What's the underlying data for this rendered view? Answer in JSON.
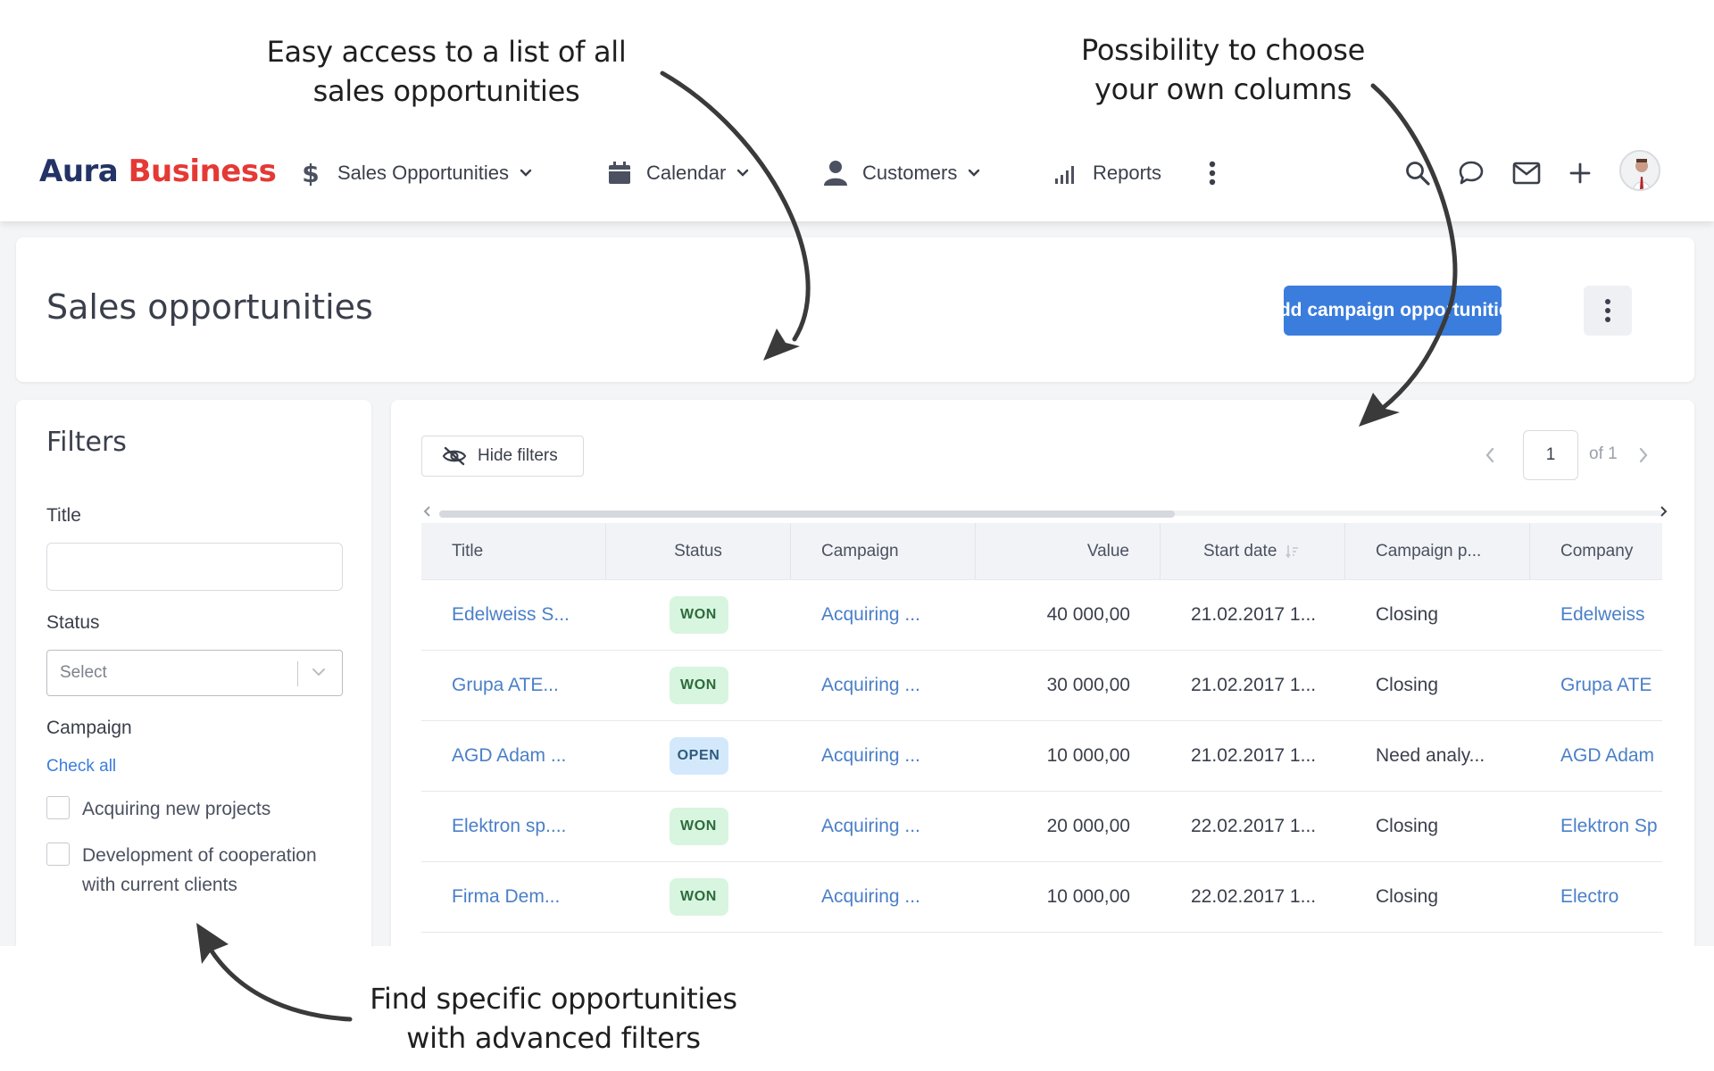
{
  "annotations": {
    "list": [
      "Easy access to a list of all",
      "sales opportunities"
    ],
    "columns": [
      "Possibility to choose",
      "your own columns"
    ],
    "filters": [
      "Find specific opportunities",
      "with advanced filters"
    ]
  },
  "brand": {
    "part1": "Aura",
    "part2": "Business",
    "color1": "#243366",
    "color2": "#e53935"
  },
  "nav": {
    "sales": "Sales Opportunities",
    "calendar": "Calendar",
    "customers": "Customers",
    "reports": "Reports"
  },
  "toolbar_icons": [
    "search-icon",
    "chat-icon",
    "mail-icon",
    "plus-icon",
    "avatar"
  ],
  "header": {
    "title": "Sales opportunities",
    "add_button": "Add campaign opportunities",
    "accent": "#3b7ddd"
  },
  "filters": {
    "title": "Filters",
    "title_label": "Title",
    "title_value": "",
    "status_label": "Status",
    "status_placeholder": "Select",
    "campaign_label": "Campaign",
    "check_all": "Check all",
    "campaign_options": [
      "Acquiring new projects",
      "Development of cooperation with current clients"
    ]
  },
  "table_toolbar": {
    "hide_filters": "Hide filters",
    "page": "1",
    "page_of": "of 1"
  },
  "table": {
    "columns": [
      "Title",
      "Status",
      "Campaign",
      "Value",
      "Start date",
      "Campaign p...",
      "Company"
    ],
    "rows": [
      {
        "title": "Edelweiss S...",
        "status": "WON",
        "campaign": "Acquiring ...",
        "value": "40 000,00",
        "start_date": "21.02.2017 1...",
        "phase": "Closing",
        "company": "Edelweiss"
      },
      {
        "title": "Grupa ATE...",
        "status": "WON",
        "campaign": "Acquiring ...",
        "value": "30 000,00",
        "start_date": "21.02.2017 1...",
        "phase": "Closing",
        "company": "Grupa ATE"
      },
      {
        "title": "AGD Adam ...",
        "status": "OPEN",
        "campaign": "Acquiring ...",
        "value": "10 000,00",
        "start_date": "21.02.2017 1...",
        "phase": "Need analy...",
        "company": "AGD Adam"
      },
      {
        "title": "Elektron sp....",
        "status": "WON",
        "campaign": "Acquiring ...",
        "value": "20 000,00",
        "start_date": "22.02.2017 1...",
        "phase": "Closing",
        "company": "Elektron Sp"
      },
      {
        "title": "Firma Dem...",
        "status": "WON",
        "campaign": "Acquiring ...",
        "value": "10 000,00",
        "start_date": "22.02.2017 1...",
        "phase": "Closing",
        "company": "Electro"
      }
    ],
    "status_colors": {
      "WON": "#d8f5df",
      "OPEN": "#d3e9fb"
    }
  }
}
